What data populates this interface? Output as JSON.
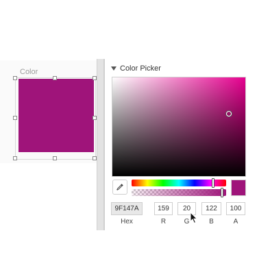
{
  "canvas": {
    "label": "Color",
    "fill": "#9F147A"
  },
  "panel": {
    "title": "Color Picker",
    "current_color": "#9F147A",
    "hue_position": 0.86,
    "alpha_position": 0.96,
    "fields": {
      "hex": {
        "value": "9F147A",
        "label": "Hex"
      },
      "r": {
        "value": "159",
        "label": "R"
      },
      "g": {
        "value": "20",
        "label": "G"
      },
      "b": {
        "value": "122",
        "label": "B"
      },
      "a": {
        "value": "100",
        "label": "A"
      }
    }
  },
  "icons": {
    "disclosure": "triangle-down-icon",
    "eyedropper": "eyedropper-icon",
    "cursor": "mouse-pointer-icon"
  }
}
